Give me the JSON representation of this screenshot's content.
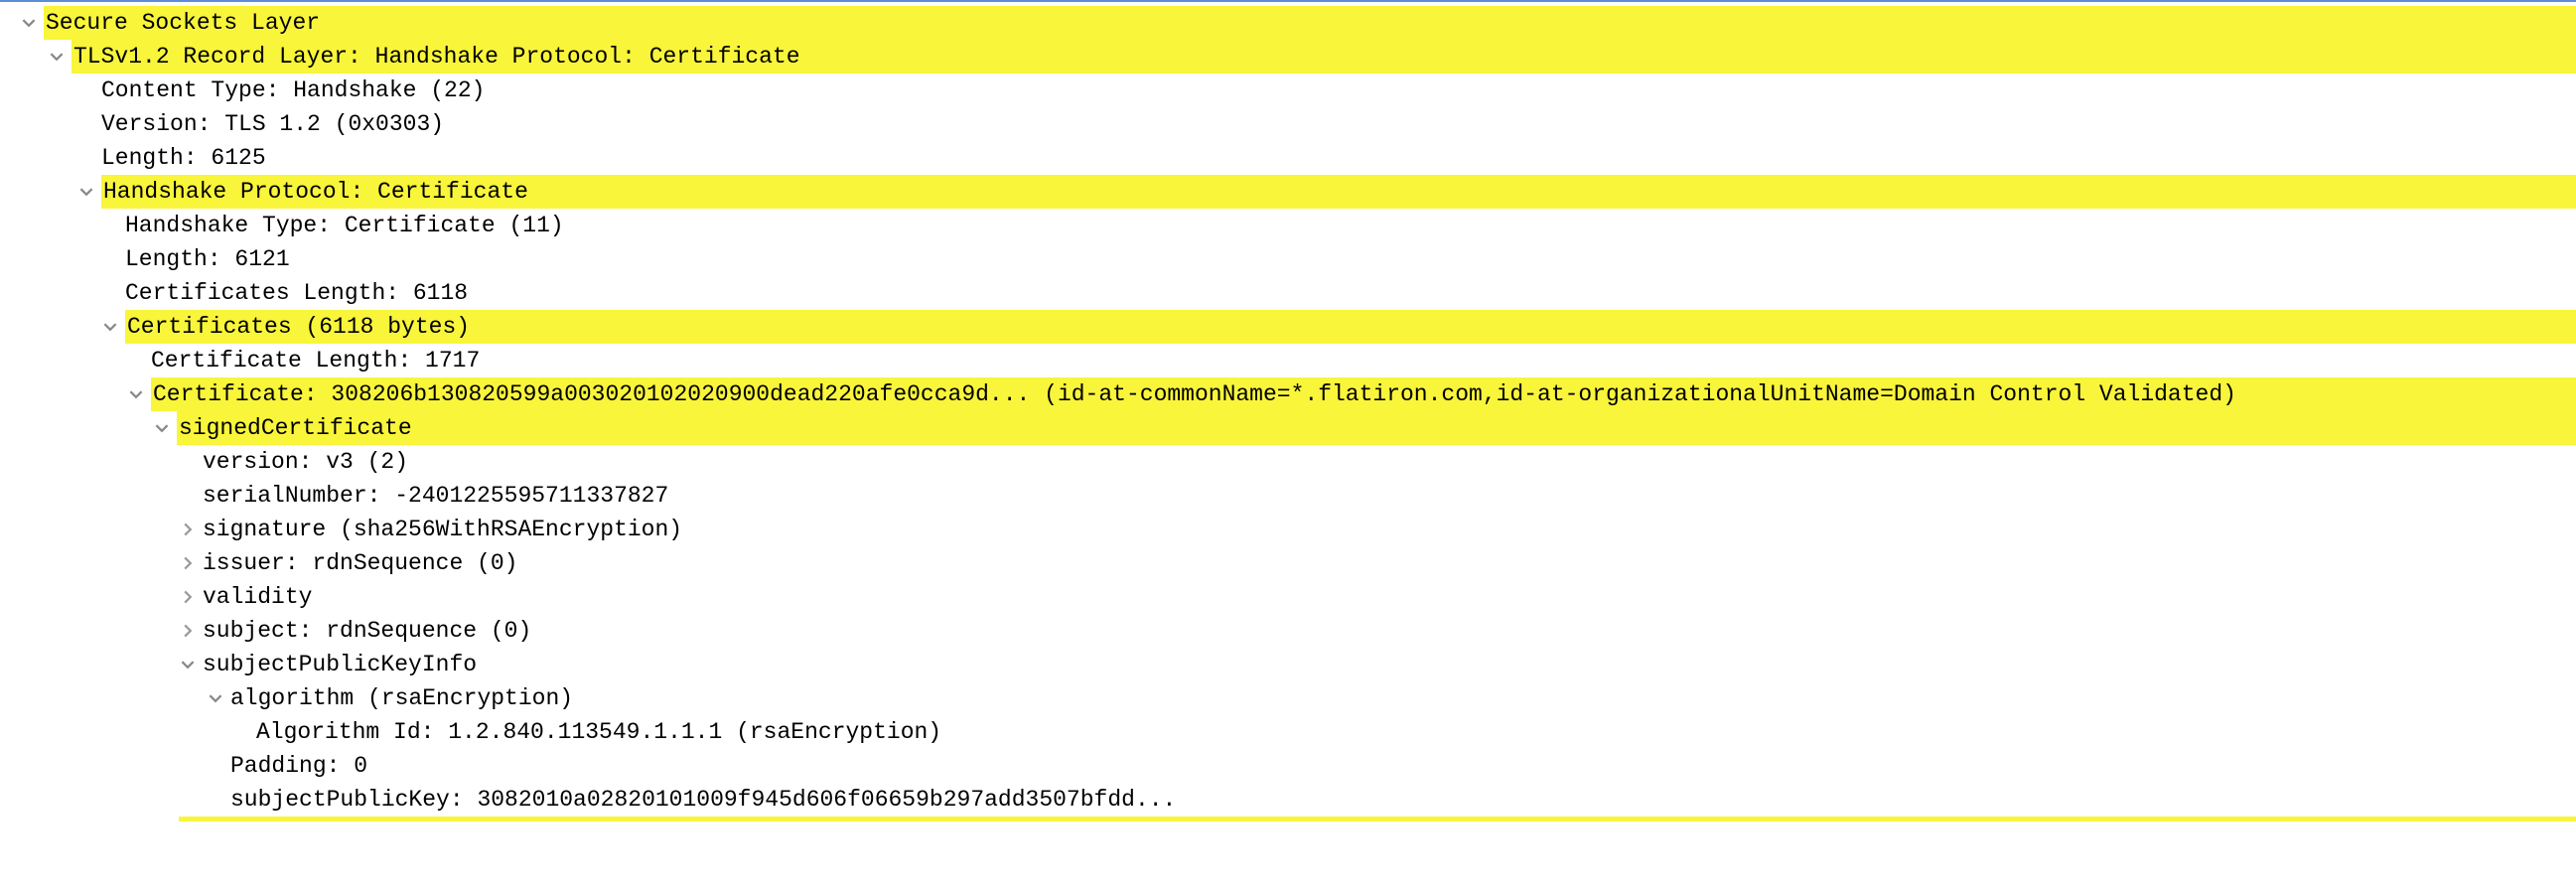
{
  "colors": {
    "highlight": "#f8f53b",
    "panel_border": "#5b8cd6"
  },
  "tree": {
    "ssl": {
      "label": "Secure Sockets Layer",
      "record": {
        "label": "TLSv1.2 Record Layer: Handshake Protocol: Certificate",
        "content_type": "Content Type: Handshake (22)",
        "version": "Version: TLS 1.2 (0x0303)",
        "length": "Length: 6125",
        "handshake": {
          "label": "Handshake Protocol: Certificate",
          "hs_type": "Handshake Type: Certificate (11)",
          "hs_length": "Length: 6121",
          "certs_length": "Certificates Length: 6118",
          "certs": {
            "label": "Certificates (6118 bytes)",
            "cert_length": "Certificate Length: 1717",
            "cert0": {
              "label": "Certificate: 308206b130820599a003020102020900dead220afe0cca9d... (id-at-commonName=*.flatiron.com,id-at-organizationalUnitName=Domain Control Validated)",
              "signed": {
                "label": "signedCertificate",
                "version": "version: v3 (2)",
                "serial": "serialNumber: -2401225595711337827",
                "signature": "signature (sha256WithRSAEncryption)",
                "issuer": "issuer: rdnSequence (0)",
                "validity": "validity",
                "subject": "subject: rdnSequence (0)",
                "spki": {
                  "label": "subjectPublicKeyInfo",
                  "algorithm": {
                    "label": "algorithm (rsaEncryption)",
                    "alg_id": "Algorithm Id: 1.2.840.113549.1.1.1 (rsaEncryption)"
                  },
                  "padding": "Padding: 0",
                  "pubkey": "subjectPublicKey: 3082010a02820101009f945d606f06659b297add3507bfdd..."
                }
              }
            }
          }
        }
      }
    }
  }
}
